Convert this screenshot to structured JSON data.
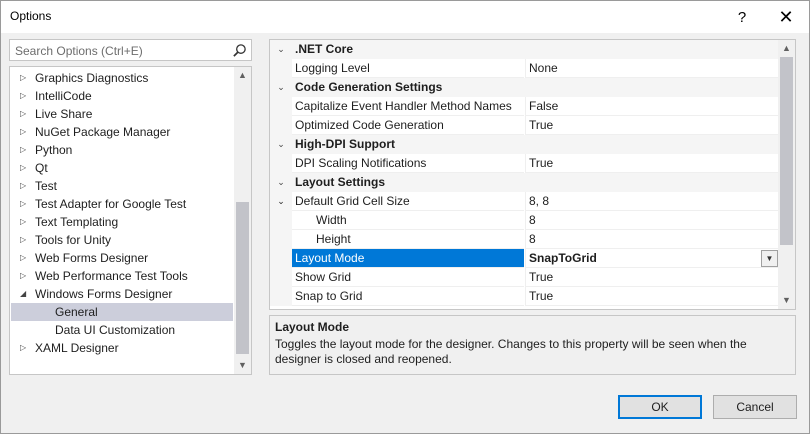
{
  "window": {
    "title": "Options",
    "help_glyph": "?",
    "close_glyph": "✕"
  },
  "search": {
    "placeholder": "Search Options (Ctrl+E)"
  },
  "tree": {
    "items": [
      {
        "label": "Graphics Diagnostics",
        "expander": "▷"
      },
      {
        "label": "IntelliCode",
        "expander": "▷"
      },
      {
        "label": "Live Share",
        "expander": "▷"
      },
      {
        "label": "NuGet Package Manager",
        "expander": "▷"
      },
      {
        "label": "Python",
        "expander": "▷"
      },
      {
        "label": "Qt",
        "expander": "▷"
      },
      {
        "label": "Test",
        "expander": "▷"
      },
      {
        "label": "Test Adapter for Google Test",
        "expander": "▷"
      },
      {
        "label": "Text Templating",
        "expander": "▷"
      },
      {
        "label": "Tools for Unity",
        "expander": "▷"
      },
      {
        "label": "Web Forms Designer",
        "expander": "▷"
      },
      {
        "label": "Web Performance Test Tools",
        "expander": "▷"
      },
      {
        "label": "Windows Forms Designer",
        "expander": "◢"
      },
      {
        "label": "General",
        "expander": ""
      },
      {
        "label": "Data UI Customization",
        "expander": ""
      },
      {
        "label": "XAML Designer",
        "expander": "▷"
      }
    ]
  },
  "grid": {
    "rows": [
      {
        "kind": "cat",
        "name": ".NET Core"
      },
      {
        "kind": "prop",
        "name": "Logging Level",
        "value": "None"
      },
      {
        "kind": "cat",
        "name": "Code Generation Settings"
      },
      {
        "kind": "prop",
        "name": "Capitalize Event Handler Method Names",
        "value": "False"
      },
      {
        "kind": "prop",
        "name": "Optimized Code Generation",
        "value": "True"
      },
      {
        "kind": "cat",
        "name": "High-DPI Support"
      },
      {
        "kind": "prop",
        "name": "DPI Scaling Notifications",
        "value": "True"
      },
      {
        "kind": "cat",
        "name": "Layout Settings"
      },
      {
        "kind": "prop",
        "name": "Default Grid Cell Size",
        "value": "8, 8"
      },
      {
        "kind": "sub",
        "name": "Width",
        "value": "8"
      },
      {
        "kind": "sub",
        "name": "Height",
        "value": "8"
      },
      {
        "kind": "prop",
        "name": "Layout Mode",
        "value": "SnapToGrid"
      },
      {
        "kind": "prop",
        "name": "Show Grid",
        "value": "True"
      },
      {
        "kind": "prop",
        "name": "Snap to Grid",
        "value": "True"
      }
    ]
  },
  "description": {
    "title": "Layout Mode",
    "text": "Toggles the layout mode for the designer. Changes to this property will be seen when the designer is closed and reopened."
  },
  "buttons": {
    "ok": "OK",
    "cancel": "Cancel"
  },
  "colors": {
    "selection_accent": "#0078d7",
    "tree_selection": "#cccedb"
  }
}
